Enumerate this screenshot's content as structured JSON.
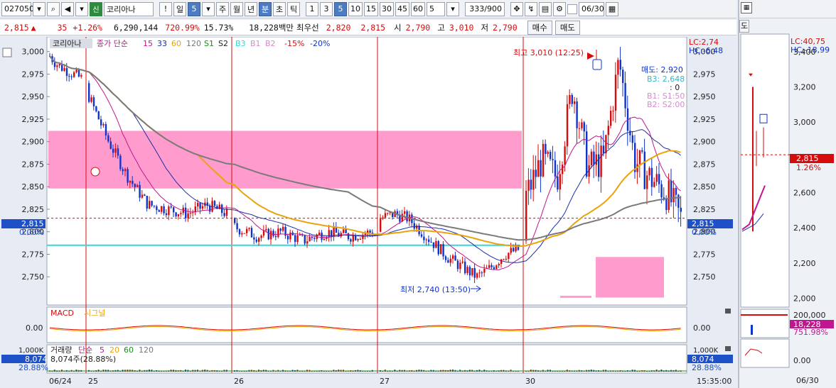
{
  "toolbar": {
    "code": "027050",
    "market_badge": "신",
    "name": "코리아나",
    "exclaim": "!",
    "period_day": "일",
    "period_num": "5",
    "periods": [
      "주",
      "월",
      "년",
      "분",
      "초",
      "틱"
    ],
    "selected_period": "분",
    "minutes": [
      "1",
      "3",
      "5",
      "10",
      "15",
      "30",
      "45",
      "60"
    ],
    "selected_minute": "5",
    "minute_input": "5",
    "count": "333/900",
    "date": "06/30"
  },
  "summary": {
    "price": "2,815",
    "change_arrow": "▲",
    "change": "35",
    "change_pct": "+1.26%",
    "volume": "6,290,144",
    "vol_ratio": "720.99%",
    "turnover": "15.73%",
    "amount": "18,228백만",
    "best_label": "최우선",
    "best_ask": "2,820",
    "best_bid": "2,815",
    "open_label": "시",
    "open": "2,790",
    "high_label": "고",
    "high": "3,010",
    "low_label": "저",
    "low": "2,790",
    "buy_button": "매수",
    "sell_button": "매도"
  },
  "legend": {
    "name": "코리아나",
    "ma_label": "종가 단순",
    "ma_periods": [
      "15",
      "33",
      "60",
      "120"
    ],
    "s1": "S1",
    "s2": "S2",
    "b3": "B3",
    "b1": "B1",
    "b2": "B2",
    "pct1": "-15%",
    "pct2": "-20%",
    "lc": "LC:2,74",
    "hc": "HC:-6,48",
    "high_annotation": "최고 3,010 (12:25)",
    "low_annotation": "최저 2,740 (13:50)",
    "order_sell": "매도: 2,920",
    "order_b3": "B3: 2,648",
    "order_zero": ": 0",
    "order_b1": "B1: S1:50",
    "order_b2": "B2: S2:00",
    "price_tag": "2,815",
    "price_tag_pct": "0.00%"
  },
  "colors": {
    "up": "#d60c0c",
    "down": "#1033c9",
    "ma15": "#c0168f",
    "ma33": "#1a2fa8",
    "ma60": "#e8a40c",
    "ma120": "#7a7a7a",
    "zone": "#ff9ccd",
    "cyan": "#35d7d9"
  },
  "chart_data": {
    "type": "candlestick",
    "ylim": [
      2725,
      3010
    ],
    "y_ticks": [
      3000,
      2975,
      2950,
      2925,
      2900,
      2875,
      2850,
      2825,
      2800,
      2775,
      2750
    ],
    "y_tick_labels": [
      "3,000",
      "2,975",
      "2,950",
      "2,925",
      "2,900",
      "2,875",
      "2,850",
      "2,825",
      "2,800",
      "2,775",
      "2,750"
    ],
    "x_labels": [
      "06/24",
      "25",
      "26",
      "27",
      "30"
    ],
    "current_price": 2815,
    "cyan_level": 2785,
    "high": 3010,
    "low": 2740,
    "sessions": [
      {
        "label": "06/24",
        "open": 2995,
        "close": 2970,
        "hi": 3000,
        "lo": 2960,
        "path": [
          2995,
          2985,
          2980,
          2975,
          2970
        ]
      },
      {
        "label": "25",
        "open": 2965,
        "close": 2820,
        "hi": 2968,
        "lo": 2805,
        "path": [
          2950,
          2900,
          2860,
          2830,
          2825,
          2820,
          2830,
          2820
        ]
      },
      {
        "label": "26",
        "open": 2815,
        "close": 2800,
        "hi": 2835,
        "lo": 2770,
        "path": [
          2805,
          2795,
          2800,
          2790,
          2800,
          2795,
          2800
        ]
      },
      {
        "label": "27",
        "open": 2800,
        "close": 2780,
        "hi": 2835,
        "lo": 2740,
        "path": [
          2815,
          2820,
          2815,
          2800,
          2785,
          2770,
          2760,
          2750,
          2760,
          2775,
          2780
        ]
      },
      {
        "label": "30",
        "open": 2790,
        "close": 2815,
        "hi": 3010,
        "lo": 2780,
        "path": [
          2840,
          2880,
          2860,
          2960,
          2870,
          2880,
          2990,
          2880,
          2860,
          2845,
          2815
        ]
      }
    ],
    "macd": {
      "title": "MACD",
      "signal": "시그널",
      "tick": "0.00"
    },
    "volume_panel": {
      "title": "거래량",
      "ma_label": "단순",
      "periods": [
        "5",
        "20",
        "60",
        "120"
      ],
      "value": "8,074주(28.88%)",
      "tick_top": "1,000K",
      "tag": "8,074",
      "tag_pct": "28.88%"
    }
  },
  "time": "15:35:00",
  "mini": {
    "lc": "LC:40,75",
    "hc": "HC:-18,99",
    "y_labels": [
      "3,400",
      "3,200",
      "3,000",
      "2,800",
      "2,600",
      "2,400",
      "2,200",
      "2,000"
    ],
    "price_tag": "2,815",
    "price_pct": "1.26%",
    "vol_label": "200,000",
    "vol_tag": "18,228",
    "vol_pct": "751.98%",
    "zero": "0.00",
    "date": "06/30"
  }
}
